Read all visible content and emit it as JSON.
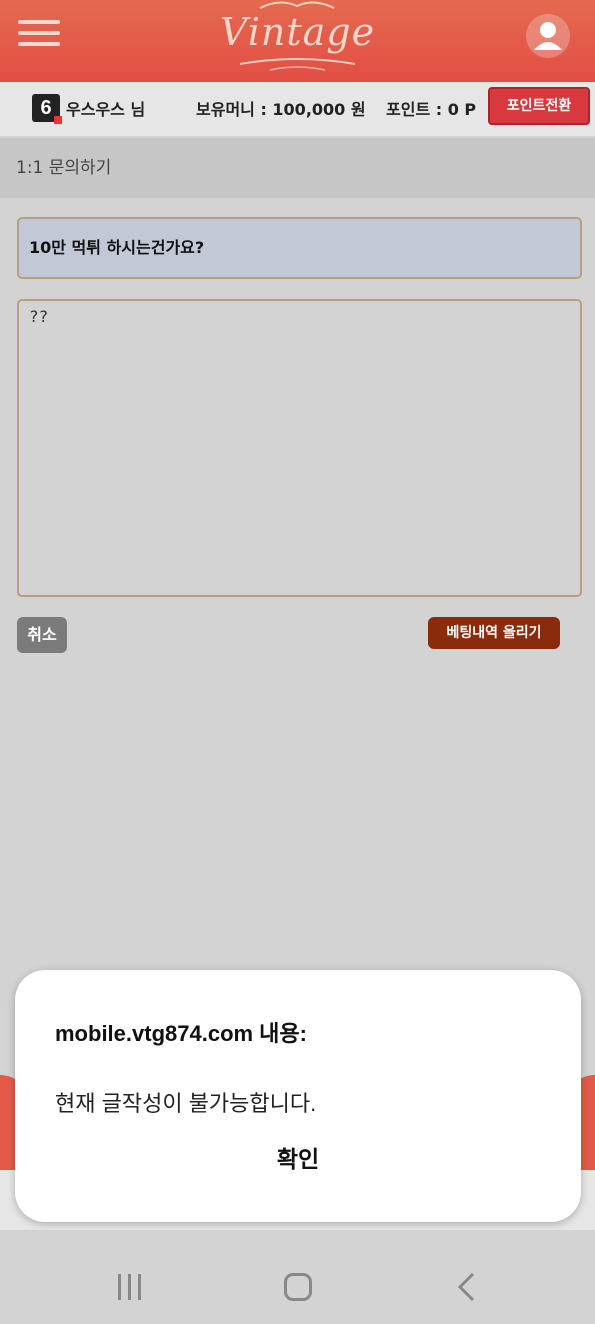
{
  "header": {
    "logo_text": "Vintage",
    "menu_icon": "hamburger-menu-icon",
    "profile_icon": "user-profile-icon",
    "brand_color": "#e24e44"
  },
  "info": {
    "level": "6",
    "username": "우스우스 님",
    "money_label": "보유머니 : 100,000 원",
    "points_label": "포인트 : 0 P",
    "point_convert_label": "포인트전환"
  },
  "page": {
    "section_title": "1:1 문의하기",
    "subject_value": "10만 먹튀 하시는건가요?",
    "content_value": "??",
    "cancel_label": "취소",
    "bet_history_label": "베팅내역 올리기"
  },
  "dialog": {
    "title": "mobile.vtg874.com 내용:",
    "message": "현재 글작성이 불가능합니다.",
    "ok_label": "확인"
  },
  "navbar": {
    "recent_icon": "recent-apps-icon",
    "home_icon": "home-icon",
    "back_icon": "back-icon"
  }
}
